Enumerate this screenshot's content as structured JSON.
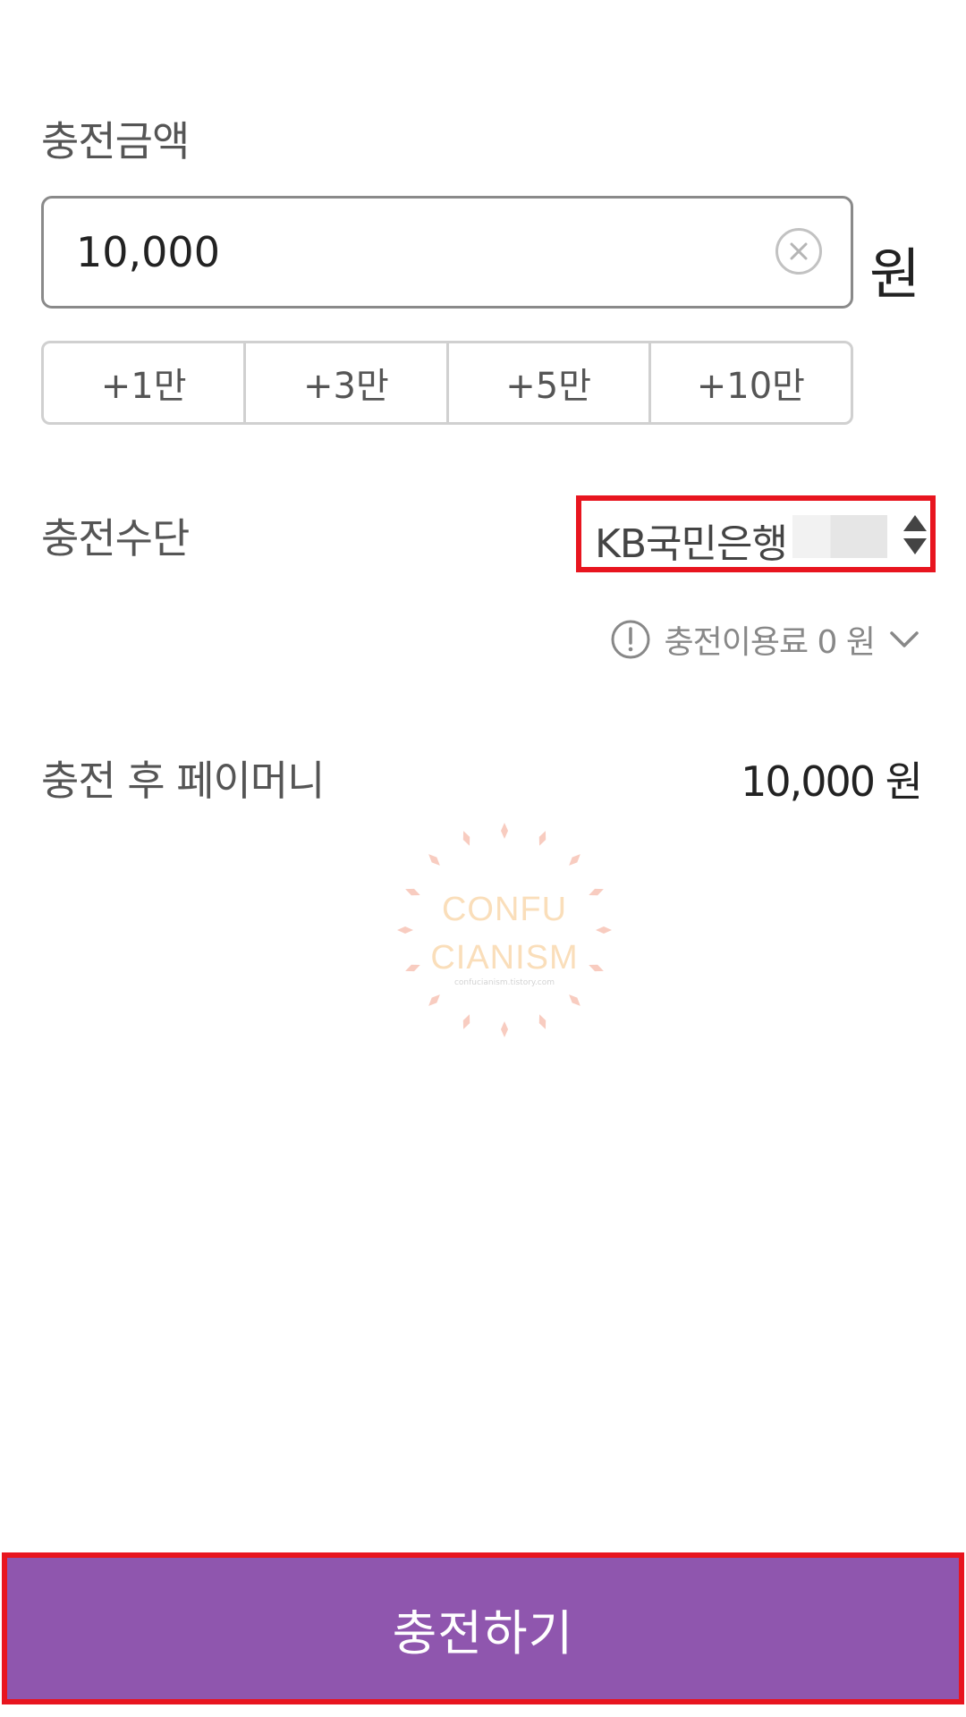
{
  "charge_amount": {
    "label": "충전금액",
    "value": "10,000",
    "unit": "원"
  },
  "quick_add": [
    {
      "label": "+1만"
    },
    {
      "label": "+3만"
    },
    {
      "label": "+5만"
    },
    {
      "label": "+10만"
    }
  ],
  "charge_method": {
    "label": "충전수단",
    "selected_bank": "KB국민은행"
  },
  "fee": {
    "text": "충전이용료 0 원"
  },
  "after_charge": {
    "label": "충전 후 페이머니",
    "value": "10,000 원"
  },
  "watermark": {
    "line1": "CONFU",
    "line2": "CIANISM",
    "sub": "confucianism.tistory.com"
  },
  "submit": {
    "label": "충전하기"
  },
  "colors": {
    "accent_purple": "#8f56ae",
    "highlight_red": "#e8151f"
  }
}
